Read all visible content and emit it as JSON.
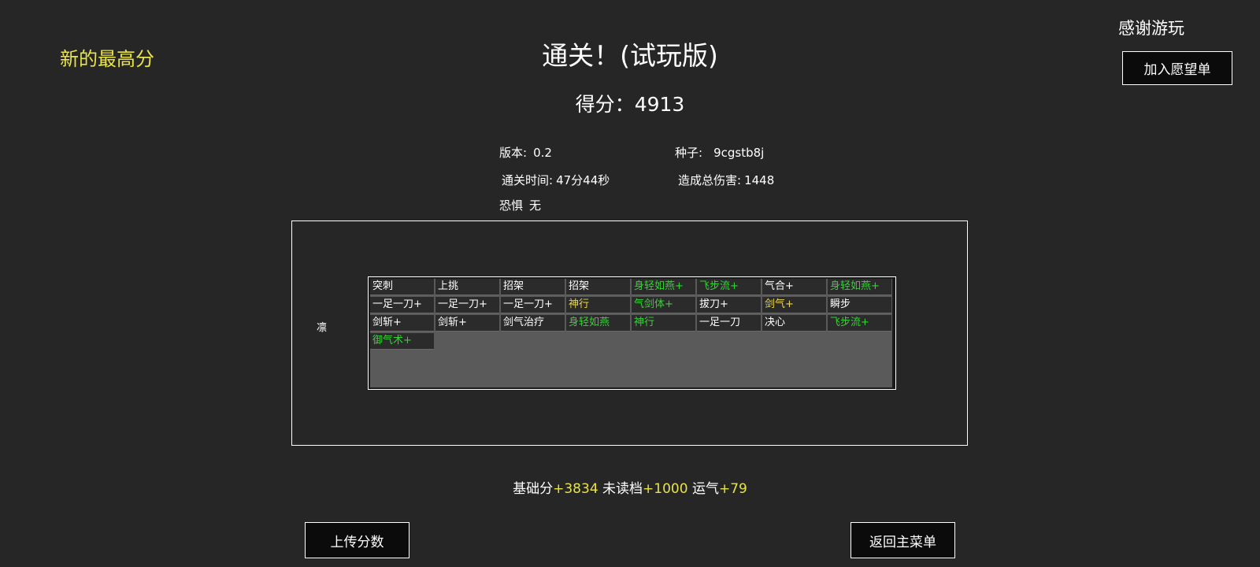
{
  "header": {
    "new_high_score": "新的最高分",
    "title": "通关！(试玩版)",
    "score_label": "得分：",
    "score_value": "4913",
    "thanks": "感谢游玩",
    "wishlist_button": "加入愿望单"
  },
  "info": {
    "version_label": "版本:",
    "version_value": "0.2",
    "seed_label": "种子:",
    "seed_value": "9cgstb8j",
    "clear_time_label": "通关时间:",
    "clear_time_value": "47分44秒",
    "damage_label": "造成总伤害:",
    "damage_value": "1448",
    "fear_label": "恐惧",
    "fear_value": "无"
  },
  "deck": {
    "character": "凛",
    "cards": [
      {
        "name": "突刺",
        "color": "white"
      },
      {
        "name": "上挑",
        "color": "white"
      },
      {
        "name": "招架",
        "color": "white"
      },
      {
        "name": "招架",
        "color": "white"
      },
      {
        "name": "身轻如燕+",
        "color": "green"
      },
      {
        "name": "飞步流+",
        "color": "green"
      },
      {
        "name": "气合+",
        "color": "white"
      },
      {
        "name": "身轻如燕+",
        "color": "green"
      },
      {
        "name": "一足一刀+",
        "color": "white"
      },
      {
        "name": "一足一刀+",
        "color": "white"
      },
      {
        "name": "一足一刀+",
        "color": "white"
      },
      {
        "name": "神行",
        "color": "yellow"
      },
      {
        "name": "气剑体+",
        "color": "green"
      },
      {
        "name": "拔刀+",
        "color": "white"
      },
      {
        "name": "剑气+",
        "color": "yellow"
      },
      {
        "name": "瞬步",
        "color": "white"
      },
      {
        "name": "剑斩+",
        "color": "white"
      },
      {
        "name": "剑斩+",
        "color": "white"
      },
      {
        "name": "剑气治疗",
        "color": "white"
      },
      {
        "name": "身轻如燕",
        "color": "green"
      },
      {
        "name": "神行",
        "color": "green"
      },
      {
        "name": "一足一刀",
        "color": "white"
      },
      {
        "name": "决心",
        "color": "white"
      },
      {
        "name": "飞步流+",
        "color": "green"
      },
      {
        "name": "御气术+",
        "color": "green"
      }
    ]
  },
  "breakdown": {
    "base_label": "基础分",
    "base_value": "+3834",
    "no_load_label": "未读档",
    "no_load_value": "+1000",
    "luck_label": "运气",
    "luck_value": "+79"
  },
  "buttons": {
    "upload": "上传分数",
    "main_menu": "返回主菜单"
  },
  "colors": {
    "background": "#262626",
    "highlight_yellow": "#e8e34a",
    "card_green": "#33d433",
    "card_yellow": "#e8d64a",
    "deck_fill": "#5a5a5a"
  }
}
